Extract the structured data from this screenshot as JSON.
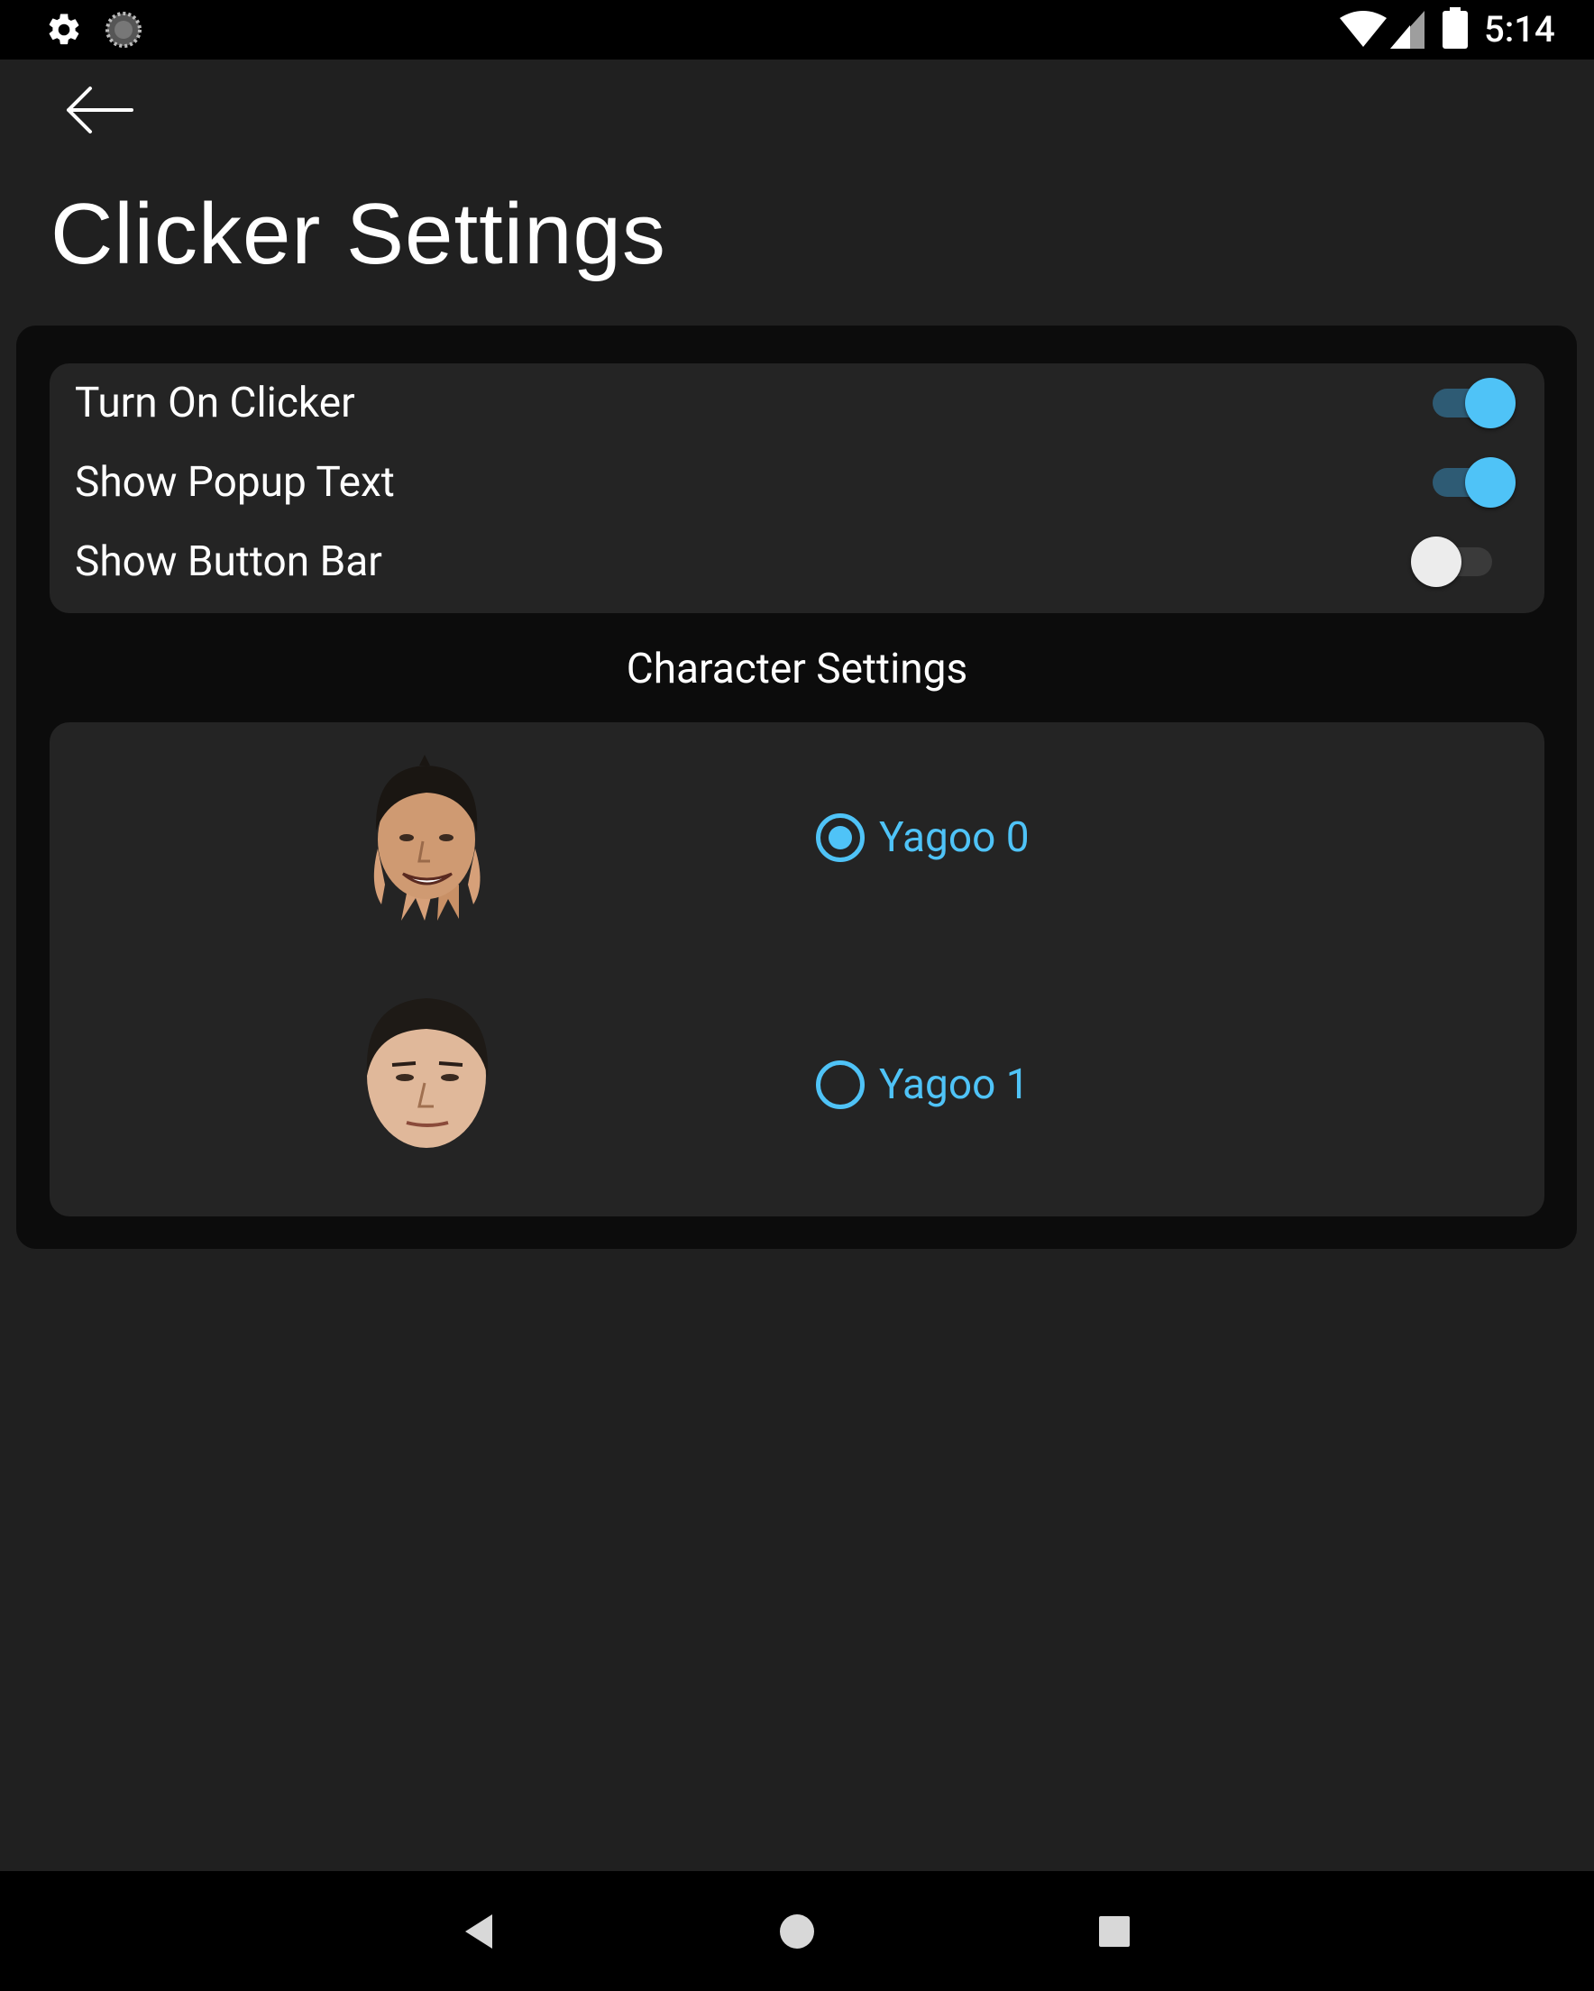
{
  "status_bar": {
    "time": "5:14",
    "left_icons": [
      "settings-gear-icon",
      "loading-spinner-icon"
    ],
    "right_icons": [
      "wifi-icon",
      "cell-signal-icon",
      "battery-icon"
    ]
  },
  "header": {
    "back_icon": "arrow-left-icon",
    "title": "Clicker Settings"
  },
  "toggles": [
    {
      "label": "Turn On Clicker",
      "checked": true
    },
    {
      "label": "Show Popup Text",
      "checked": true
    },
    {
      "label": "Show Button Bar",
      "checked": false
    }
  ],
  "character_section": {
    "heading": "Character Settings",
    "characters": [
      {
        "label": "Yagoo 0",
        "selected": true,
        "avatar": "smiling-face-with-hands"
      },
      {
        "label": "Yagoo 1",
        "selected": false,
        "avatar": "neutral-face"
      }
    ]
  },
  "nav_bar": {
    "icons": [
      "back-triangle-icon",
      "home-circle-icon",
      "recents-square-icon"
    ]
  },
  "colors": {
    "background": "#202020",
    "card_outer": "#0c0c0c",
    "card_inner": "#242424",
    "accent": "#4fc3f7"
  }
}
